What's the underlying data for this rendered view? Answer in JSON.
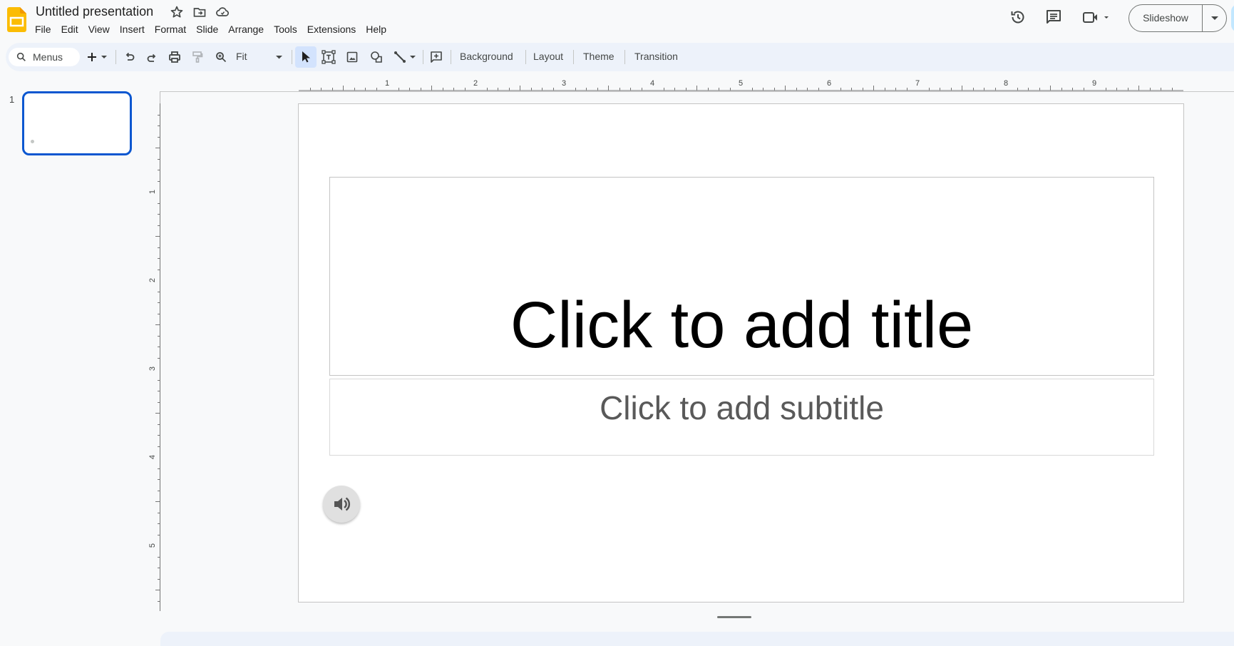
{
  "app": {
    "name": "Google Slides",
    "document_title": "Untitled presentation",
    "title_icons": [
      "star-icon",
      "move-to-folder-icon",
      "cloud-saved-icon"
    ],
    "brand_color": "#fbbc04"
  },
  "menubar": {
    "items": [
      "File",
      "Edit",
      "View",
      "Insert",
      "Format",
      "Slide",
      "Arrange",
      "Tools",
      "Extensions",
      "Help"
    ]
  },
  "top_right": {
    "icons": [
      "version-history-icon",
      "comments-icon",
      "meet-camera-icon"
    ],
    "slideshow_label": "Slideshow"
  },
  "toolbar": {
    "search_label": "Menus",
    "zoom_value": "Fit",
    "text_buttons": [
      "Background",
      "Layout",
      "Theme",
      "Transition"
    ],
    "active_tool": "select",
    "accent_color": "#d3e3fd"
  },
  "filmstrip": {
    "slides": [
      {
        "number": "1",
        "selected": true
      }
    ]
  },
  "rulers": {
    "horizontal_labels": [
      "1",
      "2",
      "3",
      "4",
      "5",
      "6",
      "7",
      "8",
      "9"
    ],
    "vertical_labels": [
      "1",
      "2",
      "3",
      "4",
      "5"
    ]
  },
  "slide": {
    "title_placeholder": "Click to add title",
    "subtitle_placeholder": "Click to add subtitle",
    "audio_icon": "speaker-icon"
  }
}
